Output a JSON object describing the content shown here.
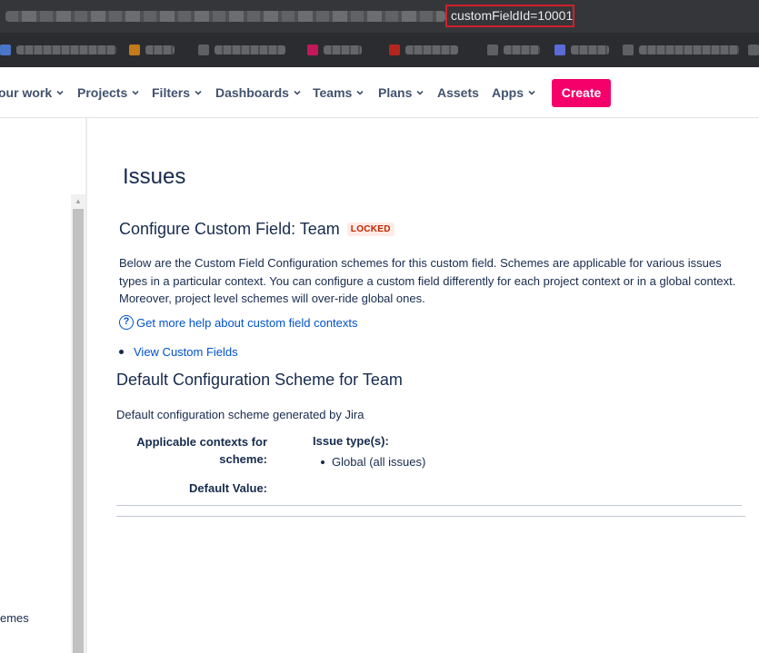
{
  "browser": {
    "url_visible": "customFieldId=10001"
  },
  "nav": {
    "items": [
      {
        "label": "our work"
      },
      {
        "label": "Projects"
      },
      {
        "label": "Filters"
      },
      {
        "label": "Dashboards"
      },
      {
        "label": "Teams"
      },
      {
        "label": "Plans"
      },
      {
        "label": "Assets"
      },
      {
        "label": "Apps"
      }
    ],
    "create_label": "Create"
  },
  "sidebar": {
    "partial_item": "emes"
  },
  "main": {
    "page_title": "Issues",
    "field_title": "Configure Custom Field: Team",
    "locked_badge": "LOCKED",
    "description": "Below are the Custom Field Configuration schemes for this custom field. Schemes are applicable for various issues types in a particular context. You can configure a custom field differently for each project context or in a global context. Moreover, project level schemes will over-ride global ones.",
    "help_link": "Get more help about custom field contexts",
    "view_link": "View Custom Fields",
    "scheme_title": "Default Configuration Scheme for Team",
    "scheme_description": "Default configuration scheme generated by Jira",
    "contexts_label_line1": "Applicable contexts for",
    "contexts_label_line2": "scheme:",
    "issue_types_heading": "Issue type(s):",
    "issue_types": [
      "Global (all issues)"
    ],
    "default_value_label": "Default Value:"
  },
  "colors": {
    "create_button": "#f5006b",
    "link": "#0052cc",
    "locked_text": "#bf2600",
    "locked_bg": "#ffebe6",
    "highlight_border": "#d0202b"
  },
  "icons": [
    "chevron-down-icon",
    "help-circle-icon",
    "scroll-up-arrow-icon"
  ]
}
